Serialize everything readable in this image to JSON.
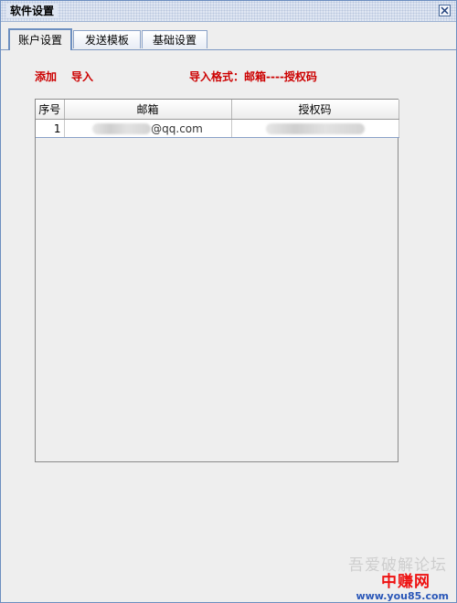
{
  "window": {
    "title": "软件设置"
  },
  "tabs": [
    {
      "label": "账户设置",
      "active": true
    },
    {
      "label": "发送模板",
      "active": false
    },
    {
      "label": "基础设置",
      "active": false
    }
  ],
  "account": {
    "add_label": "添加",
    "import_label": "导入",
    "format_hint": "导入格式：邮箱----授权码",
    "table": {
      "headers": [
        "序号",
        "邮箱",
        "授权码"
      ],
      "rows": [
        {
          "index": "1",
          "email_suffix": "@qq.com",
          "auth_code": ""
        }
      ]
    }
  },
  "watermark": {
    "line1": "吾爱破解论坛",
    "line2": "中赚网",
    "line3": "www.you85.com"
  },
  "colors": {
    "accent": "#cc0000",
    "border": "#6d8fc0"
  }
}
